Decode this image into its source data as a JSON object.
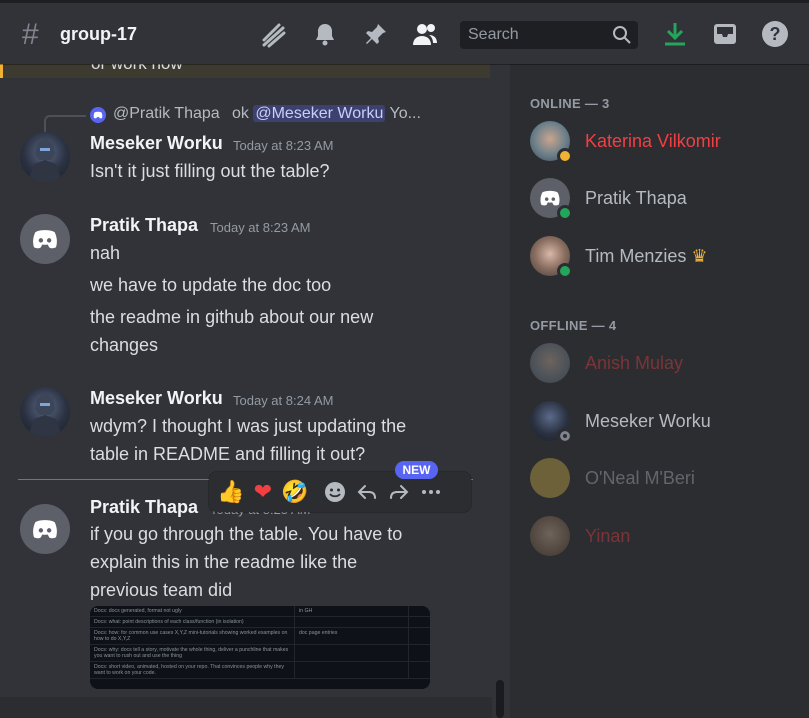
{
  "header": {
    "hash_icon": "#",
    "channel_name": "group-17",
    "search_placeholder": "Search",
    "icons": [
      "threads-icon",
      "bell-icon",
      "pin-icon",
      "members-icon",
      "download-icon",
      "inbox-icon",
      "help-icon"
    ]
  },
  "chat": {
    "top_partial_text": "or work now",
    "reply": {
      "author": "@Pratik Thapa",
      "text_before": "ok",
      "mention": "@Meseker Worku",
      "text_after": "Yo..."
    },
    "messages": [
      {
        "author": "Meseker Worku",
        "timestamp": "Today at 8:23 AM",
        "lines": [
          "Isn't it just filling out the table?"
        ]
      },
      {
        "author": "Pratik Thapa",
        "timestamp": "Today at 8:23 AM",
        "lines": [
          "nah",
          "we have to update the doc too",
          "the readme in github about our new changes"
        ]
      },
      {
        "author": "Meseker Worku",
        "timestamp": "Today at 8:24 AM",
        "lines": [
          "wdym? I thought I was just updating the table in README and filling it out?"
        ]
      },
      {
        "author": "Pratik Thapa",
        "timestamp": "Today at 8:25 AM",
        "lines": [
          "if you go through the table. You have to explain this in the readme like the previous team did"
        ]
      }
    ],
    "reactions": {
      "thumbs_up": "👍",
      "heart": "❤",
      "laughing": "🤣",
      "new_badge": "NEW"
    },
    "embed_table": [
      [
        "Docs: docs generated, format not ugly",
        "in GH",
        ""
      ],
      [
        "Docs: what: point descriptions of each class/function (in isolation)",
        "",
        ""
      ],
      [
        "Docs: how: for common use cases X,Y,Z mini-tutorials showing worked examples on how to do X,Y,Z",
        "doc page entries",
        ""
      ],
      [
        "Docs: why: docs tell a story, motivate the whole thing, deliver a punchline that makes you want to rush out and use the thing",
        "",
        ""
      ],
      [
        "Docs: short video, animated, hosted on your repo. That convinces people why they want to work on your code.",
        "",
        ""
      ]
    ]
  },
  "members": {
    "online_title": "ONLINE — 3",
    "offline_title": "OFFLINE — 4",
    "online": [
      {
        "name": "Katerina Vilkomir",
        "color": "#f23f43",
        "status": "idle"
      },
      {
        "name": "Pratik Thapa",
        "color": "#b5bac1",
        "status": "online"
      },
      {
        "name": "Tim Menzies",
        "color": "#b5bac1",
        "status": "online",
        "crown": "♛"
      }
    ],
    "offline": [
      {
        "name": "Anish Mulay",
        "color": "#f23f43"
      },
      {
        "name": "Meseker Worku",
        "color": "#dbdee1"
      },
      {
        "name": "O'Neal M'Beri",
        "color": "#b5bac1"
      },
      {
        "name": "Yinan",
        "color": "#f23f43"
      }
    ]
  },
  "colors": {
    "background": "#313338",
    "sidebar": "#2b2d31",
    "accent": "#5865f2",
    "online": "#23a55a",
    "idle": "#f0b232",
    "danger": "#f23f43"
  }
}
